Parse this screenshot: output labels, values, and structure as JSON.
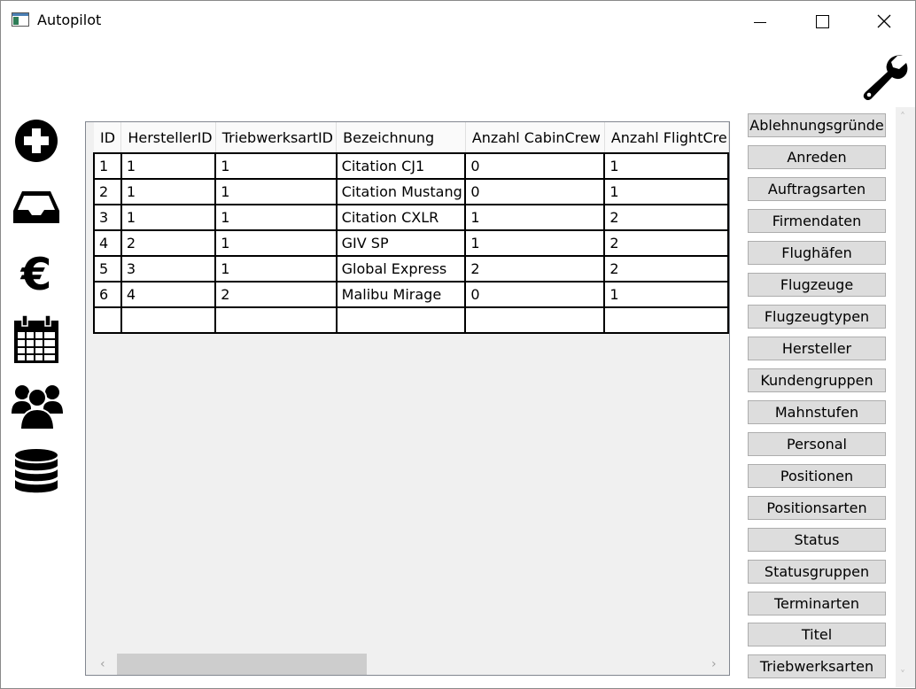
{
  "window": {
    "title": "Autopilot"
  },
  "icons": {
    "app": "app-window-icon",
    "settings": "wrench-icon",
    "nav": [
      "add-circle-icon",
      "inbox-tray-icon",
      "euro-icon",
      "calendar-icon",
      "people-group-icon",
      "database-icon"
    ]
  },
  "grid": {
    "columns": [
      "ID",
      "HerstellerID",
      "TriebwerksartID",
      "Bezeichnung",
      "Anzahl CabinCrew",
      "Anzahl FlightCre"
    ],
    "rows": [
      [
        "1",
        "1",
        "1",
        "Citation CJ1",
        "0",
        "1"
      ],
      [
        "2",
        "1",
        "1",
        "Citation Mustang",
        "0",
        "1"
      ],
      [
        "3",
        "1",
        "1",
        "Citation CXLR",
        "1",
        "2"
      ],
      [
        "4",
        "2",
        "1",
        "GIV SP",
        "1",
        "2"
      ],
      [
        "5",
        "3",
        "1",
        "Global Express",
        "2",
        "2"
      ],
      [
        "6",
        "4",
        "2",
        "Malibu Mirage",
        "0",
        "1"
      ],
      [
        "",
        "",
        "",
        "",
        "",
        ""
      ]
    ]
  },
  "tables_list": [
    "Ablehnungsgründe",
    "Anreden",
    "Auftragsarten",
    "Firmendaten",
    "Flughäfen",
    "Flugzeuge",
    "Flugzeugtypen",
    "Hersteller",
    "Kundengruppen",
    "Mahnstufen",
    "Personal",
    "Positionen",
    "Positionsarten",
    "Status",
    "Statusgruppen",
    "Terminarten",
    "Titel",
    "Triebwerksarten"
  ]
}
